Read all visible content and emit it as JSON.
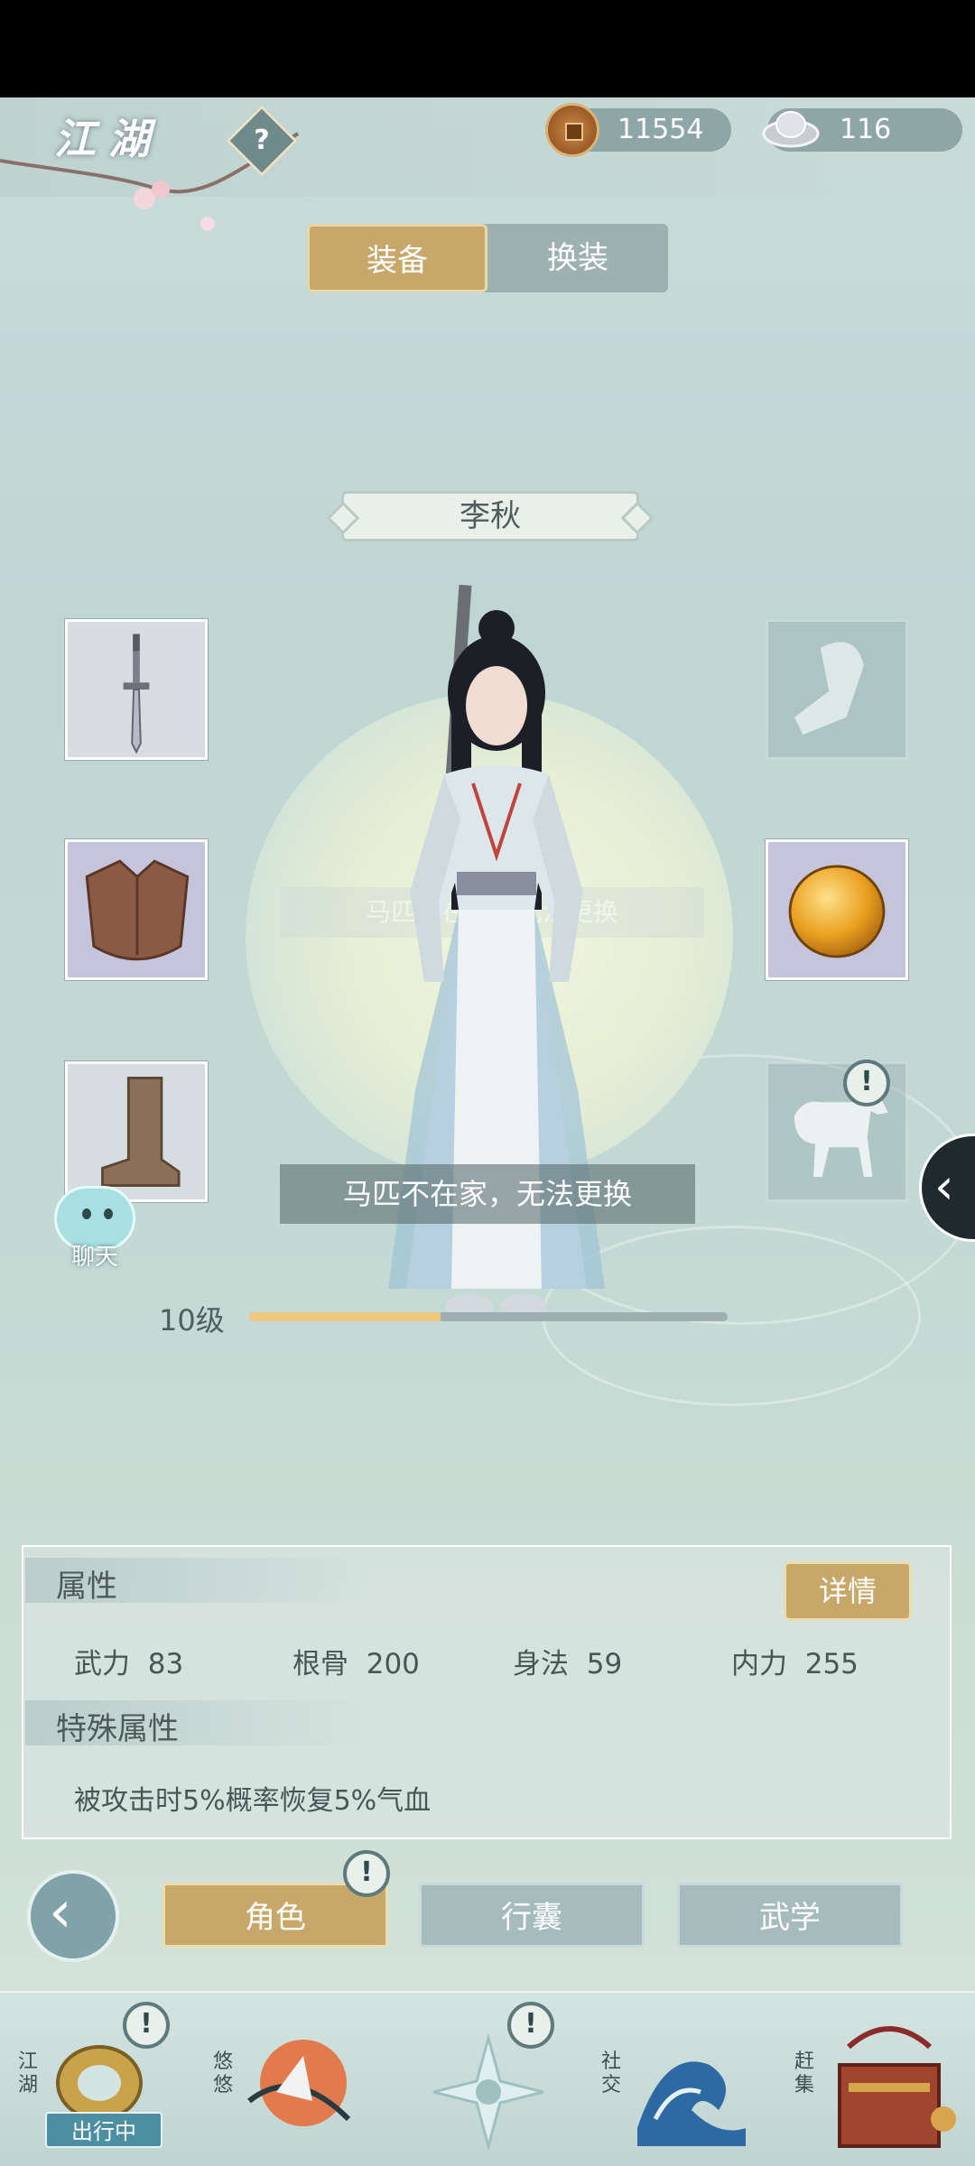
{
  "header": {
    "title": "江湖",
    "help_icon": "question-diamond-icon"
  },
  "currencies": {
    "copper": {
      "value": "11554",
      "icon": "copper-coin-icon"
    },
    "silver": {
      "value": "116",
      "icon": "silver-ingot-icon"
    }
  },
  "tabs": [
    {
      "label": "装备",
      "active": true
    },
    {
      "label": "换装",
      "active": false
    }
  ],
  "character": {
    "name": "李秋",
    "level_label": "10级",
    "xp_progress": 0.4
  },
  "equipment": {
    "left": [
      {
        "icon": "sword-icon"
      },
      {
        "icon": "armor-vest-icon"
      },
      {
        "icon": "boot-icon"
      }
    ],
    "right": [
      {
        "icon": "wrist-wrap-icon",
        "empty": true
      },
      {
        "icon": "amber-gem-icon"
      },
      {
        "icon": "horse-icon",
        "empty": true,
        "alert": true
      }
    ]
  },
  "faded_message": "马匹不在家，无法更换",
  "toast": "马匹不在家，无法更换",
  "chat": {
    "label": "聊天"
  },
  "attributes": {
    "title": "属性",
    "detail_button": "详情",
    "stats": [
      {
        "name": "武力",
        "value": "83"
      },
      {
        "name": "根骨",
        "value": "200"
      },
      {
        "name": "身法",
        "value": "59"
      },
      {
        "name": "内力",
        "value": "255"
      }
    ],
    "special_title": "特殊属性",
    "special_text": "被攻击时5%概率恢复5%气血"
  },
  "bottom_tabs": [
    {
      "label": "角色",
      "active": true
    },
    {
      "label": "行囊",
      "active": false
    },
    {
      "label": "武学",
      "active": false
    }
  ],
  "bottom_nav": [
    {
      "label": "江湖",
      "badge": "出行中",
      "icon": "jianghu-icon",
      "alert": true
    },
    {
      "label": "悠悠",
      "icon": "crane-icon"
    },
    {
      "label": "",
      "icon": "compass-star-icon",
      "alert": true
    },
    {
      "label": "社交",
      "icon": "wave-icon"
    },
    {
      "label": "赶集",
      "icon": "market-basket-icon"
    }
  ],
  "colors": {
    "accent_gold": "#c7a86a",
    "background": "#c3d9d3",
    "xp_fill": "#f0c77c"
  }
}
